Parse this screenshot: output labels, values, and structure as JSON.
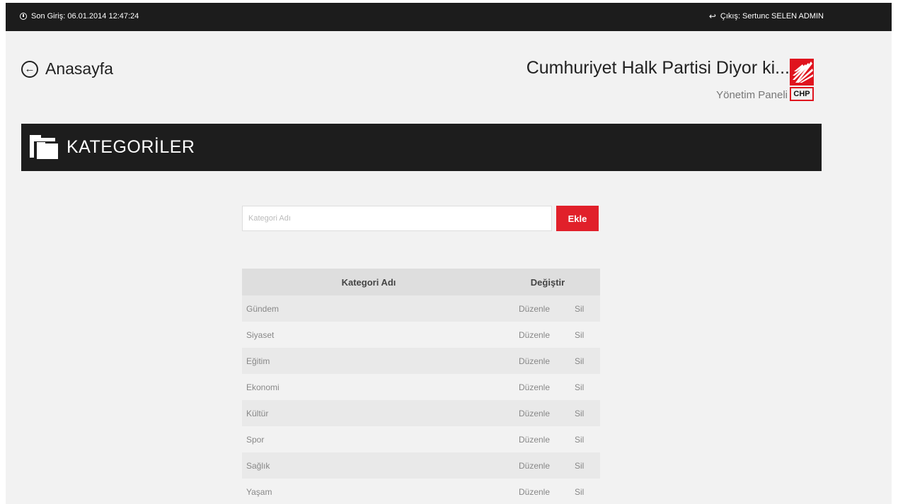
{
  "topbar": {
    "last_login": "Son Giriş: 06.01.2014 12:47:24",
    "logout": "Çıkış: Sertunc SELEN ADMIN"
  },
  "nav": {
    "home_label": "Anasayfa"
  },
  "site": {
    "title": "Cumhuriyet Halk Partisi Diyor ki...",
    "subtitle": "Yönetim Paneli",
    "logo_text": "CHP"
  },
  "page": {
    "title": "KATEGORİLER"
  },
  "form": {
    "placeholder": "Kategori Adı",
    "value": "",
    "add_label": "Ekle"
  },
  "table": {
    "headers": {
      "name": "Kategori Adı",
      "actions": "Değiştir"
    },
    "rows": [
      {
        "name": "Gündem",
        "edit": "Düzenle",
        "delete": "Sil"
      },
      {
        "name": "Siyaset",
        "edit": "Düzenle",
        "delete": "Sil"
      },
      {
        "name": "Eğitim",
        "edit": "Düzenle",
        "delete": "Sil"
      },
      {
        "name": "Ekonomi",
        "edit": "Düzenle",
        "delete": "Sil"
      },
      {
        "name": "Kültür",
        "edit": "Düzenle",
        "delete": "Sil"
      },
      {
        "name": "Spor",
        "edit": "Düzenle",
        "delete": "Sil"
      },
      {
        "name": "Sağlık",
        "edit": "Düzenle",
        "delete": "Sil"
      },
      {
        "name": "Yaşam",
        "edit": "Düzenle",
        "delete": "Sil"
      }
    ]
  },
  "colors": {
    "accent": "#e1202a",
    "bar": "#1c1c1c",
    "background": "#f2f2f2"
  },
  "icons": [
    "clock-icon",
    "logout-icon",
    "back-arrow-icon",
    "folder-icon",
    "chp-logo"
  ]
}
